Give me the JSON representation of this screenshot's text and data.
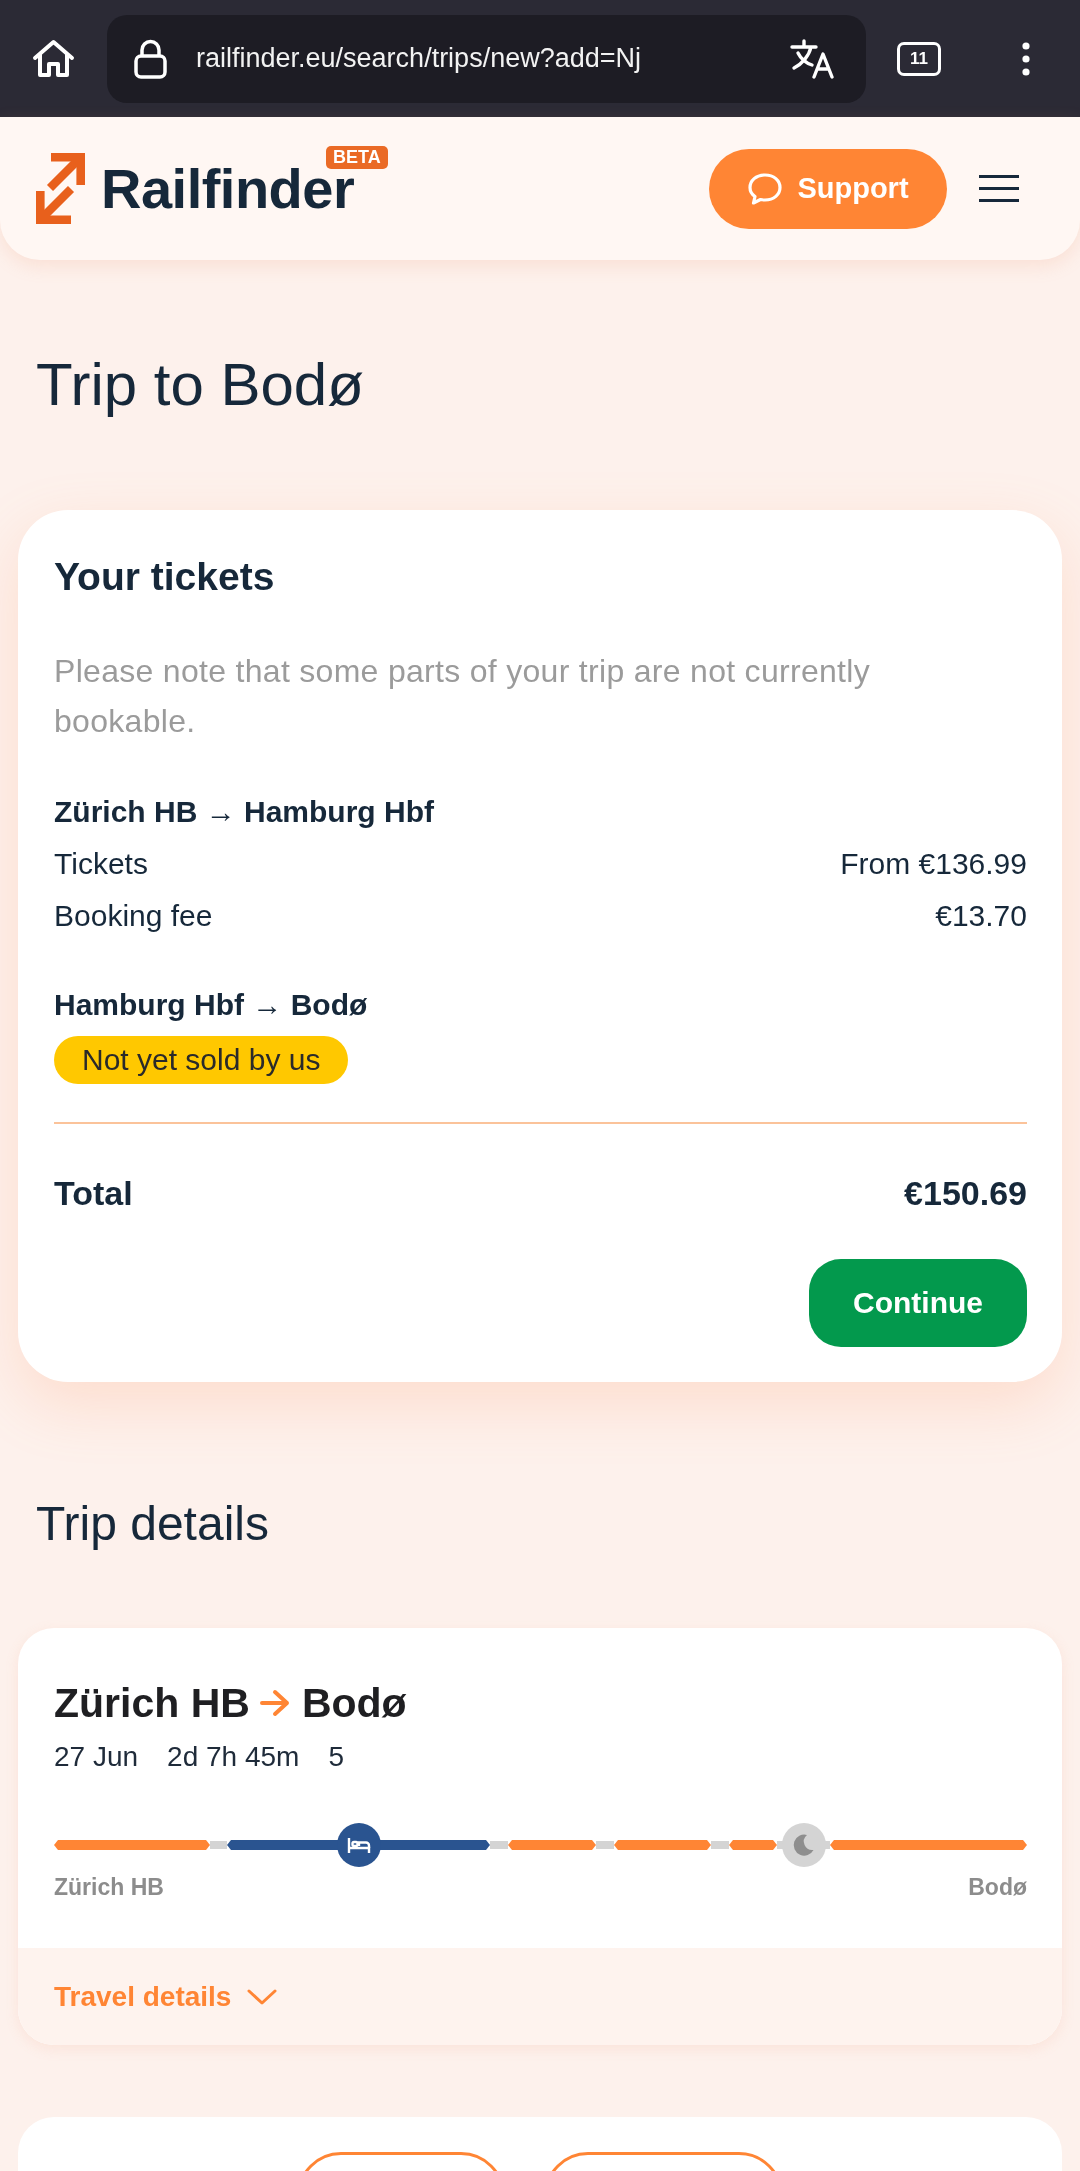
{
  "browser": {
    "url": "railfinder.eu/search/trips/new?add=Nj",
    "tab_count": "11"
  },
  "header": {
    "logo": "Railfinder",
    "badge": "BETA",
    "support": "Support"
  },
  "title": "Trip to Bodø",
  "tickets": {
    "heading": "Your tickets",
    "note": "Please note that some parts of your trip are not currently bookable.",
    "legs": [
      {
        "route": "Zürich HB → Hamburg Hbf",
        "lines": [
          {
            "label": "Tickets",
            "amount": "From €136.99"
          },
          {
            "label": "Booking fee",
            "amount": "€13.70"
          }
        ]
      },
      {
        "route": "Hamburg Hbf → Bodø",
        "status": "Not yet sold by us"
      }
    ],
    "total": {
      "label": "Total",
      "amount": "€150.69"
    },
    "action": "Continue"
  },
  "details_heading": "Trip details",
  "trip": {
    "from": "Zürich HB",
    "to": "Bodø",
    "date": "27 Jun",
    "duration": "2d 7h 45m",
    "count": "5",
    "timeline": [
      {
        "kind": "train"
      },
      {
        "kind": "transfer"
      },
      {
        "kind": "sleeper"
      },
      {
        "kind": "transfer"
      },
      {
        "kind": "train"
      },
      {
        "kind": "transfer"
      },
      {
        "kind": "train"
      },
      {
        "kind": "transfer"
      },
      {
        "kind": "train"
      },
      {
        "kind": "overnight"
      },
      {
        "kind": "train"
      }
    ],
    "start_label": "Zürich HB",
    "end_label": "Bodø",
    "travel_details": {
      "label": "Travel details",
      "expanded": false
    }
  },
  "bottom_card": {
    "buttons": [
      {
        "kind": "outlined"
      },
      {
        "kind": "outlined"
      }
    ]
  }
}
